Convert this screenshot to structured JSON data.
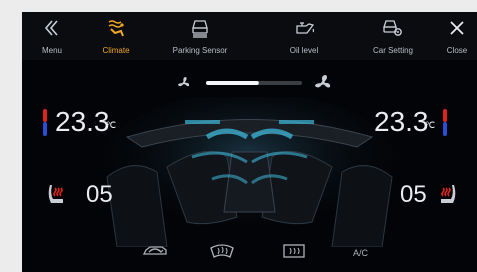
{
  "nav": {
    "tabs": [
      {
        "label": "Menu",
        "icon": "chevron-left-icon",
        "active": false
      },
      {
        "label": "Climate",
        "icon": "climate-icon",
        "active": true
      },
      {
        "label": "Parking Sensor",
        "icon": "parking-sensor-icon",
        "active": false
      },
      {
        "label": "Oil level",
        "icon": "oil-can-icon",
        "active": false
      },
      {
        "label": "Car Setting",
        "icon": "car-settings-icon",
        "active": false
      },
      {
        "label": "Close",
        "icon": "close-icon",
        "active": false
      }
    ]
  },
  "fan": {
    "level": 0.55,
    "icons": [
      "fan-low-icon",
      "fan-high-icon"
    ]
  },
  "left": {
    "temp": "23.3",
    "unit": "℃",
    "seat_level": "05"
  },
  "right": {
    "temp": "23.3",
    "unit": "℃",
    "seat_level": "05"
  },
  "bottom": {
    "ac_label": "A/C",
    "icons": [
      "recirculation-icon",
      "rear-defrost-icon",
      "front-defrost-icon"
    ]
  },
  "colors": {
    "accent": "#f2a821",
    "cool": "#3fb8d8",
    "hot": "#e0231c",
    "cold": "#2a4fd6"
  }
}
